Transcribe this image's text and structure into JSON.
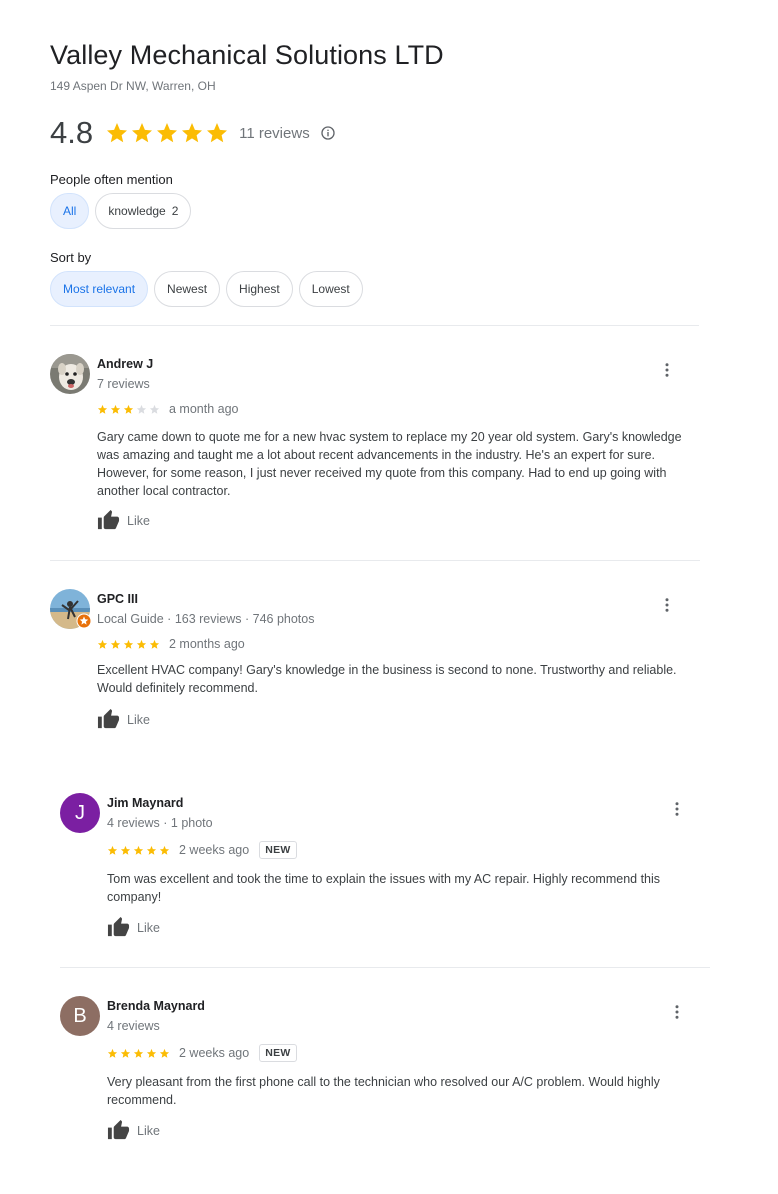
{
  "business": {
    "name": "Valley Mechanical Solutions LTD",
    "address": "149 Aspen Dr NW, Warren, OH",
    "rating": "4.8",
    "rating_stars": 5,
    "review_count": "11 reviews"
  },
  "mentions": {
    "label": "People often mention",
    "chips": [
      {
        "label": "All"
      },
      {
        "label": "knowledge",
        "count": "2"
      }
    ]
  },
  "sort": {
    "label": "Sort by",
    "chips": [
      {
        "label": "Most relevant"
      },
      {
        "label": "Newest"
      },
      {
        "label": "Highest"
      },
      {
        "label": "Lowest"
      }
    ]
  },
  "reviews": [
    {
      "name": "Andrew J",
      "meta": "7 reviews",
      "stars": 3,
      "date": "a month ago",
      "text": "Gary came down to quote me for a new hvac system to replace my 20 year old system. Gary's knowledge was amazing and taught me a lot about recent advancements in the industry. He's an expert for sure. However, for some reason, I just never received my quote from this company. Had to end up going with another local contractor.",
      "like_label": "Like"
    },
    {
      "name": "GPC III",
      "meta": "Local Guide · 163 reviews · 746 photos",
      "stars": 5,
      "date": "2 months ago",
      "text": "Excellent HVAC company! Gary's knowledge in the business is second to none. Trustworthy and reliable. Would definitely recommend.",
      "like_label": "Like"
    },
    {
      "name": "Jim Maynard",
      "initial": "J",
      "avatar_color": "#7b1fa2",
      "meta": "4 reviews · 1 photo",
      "stars": 5,
      "date": "2 weeks ago",
      "badge": "NEW",
      "text": "Tom was excellent and took the time to explain the issues with my AC repair.  Highly recommend this company!",
      "like_label": "Like"
    },
    {
      "name": "Brenda Maynard",
      "initial": "B",
      "avatar_color": "#8d6e63",
      "meta": "4 reviews",
      "stars": 5,
      "date": "2 weeks ago",
      "badge": "NEW",
      "text": "Very pleasant from the first phone call to the technician who resolved our A/C problem. Would highly recommend.",
      "like_label": "Like"
    }
  ],
  "colors": {
    "star": "#fbbc04",
    "star_empty": "#dadce0",
    "accent": "#1a73e8",
    "chip_active_bg": "#e8f0fe"
  }
}
